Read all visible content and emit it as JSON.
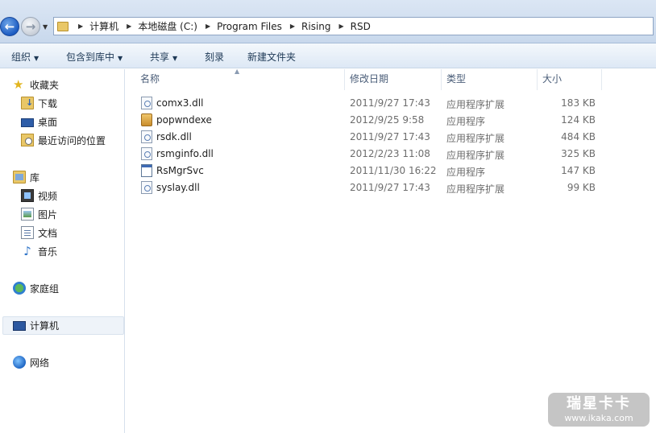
{
  "address_bar": {
    "breadcrumbs": [
      "计算机",
      "本地磁盘 (C:)",
      "Program Files",
      "Rising",
      "RSD"
    ]
  },
  "toolbar": {
    "organize": "组织",
    "include_in_library": "包含到库中",
    "share": "共享",
    "burn": "刻录",
    "new_folder": "新建文件夹"
  },
  "nav": {
    "favorites": "收藏夹",
    "downloads": "下载",
    "desktop": "桌面",
    "recent": "最近访问的位置",
    "libraries": "库",
    "videos": "视频",
    "pictures": "图片",
    "documents": "文档",
    "music": "音乐",
    "homegroup": "家庭组",
    "computer": "计算机",
    "network": "网络"
  },
  "columns": {
    "name": "名称",
    "date": "修改日期",
    "type": "类型",
    "size": "大小"
  },
  "files": [
    {
      "name": "comx3.dll",
      "date": "2011/9/27 17:43",
      "type": "应用程序扩展",
      "size": "183 KB",
      "icon": "dll-file-icon"
    },
    {
      "name": "popwndexe",
      "date": "2012/9/25 9:58",
      "type": "应用程序",
      "size": "124 KB",
      "icon": "package-icon"
    },
    {
      "name": "rsdk.dll",
      "date": "2011/9/27 17:43",
      "type": "应用程序扩展",
      "size": "484 KB",
      "icon": "dll-file-icon"
    },
    {
      "name": "rsmginfo.dll",
      "date": "2012/2/23 11:08",
      "type": "应用程序扩展",
      "size": "325 KB",
      "icon": "dll-file-icon"
    },
    {
      "name": "RsMgrSvc",
      "date": "2011/11/30 16:22",
      "type": "应用程序",
      "size": "147 KB",
      "icon": "exe-file-icon"
    },
    {
      "name": "syslay.dll",
      "date": "2011/9/27 17:43",
      "type": "应用程序扩展",
      "size": "99 KB",
      "icon": "dll-file-icon"
    }
  ],
  "watermark": {
    "title": "瑞星卡卡",
    "url": "www.ikaka.com"
  }
}
